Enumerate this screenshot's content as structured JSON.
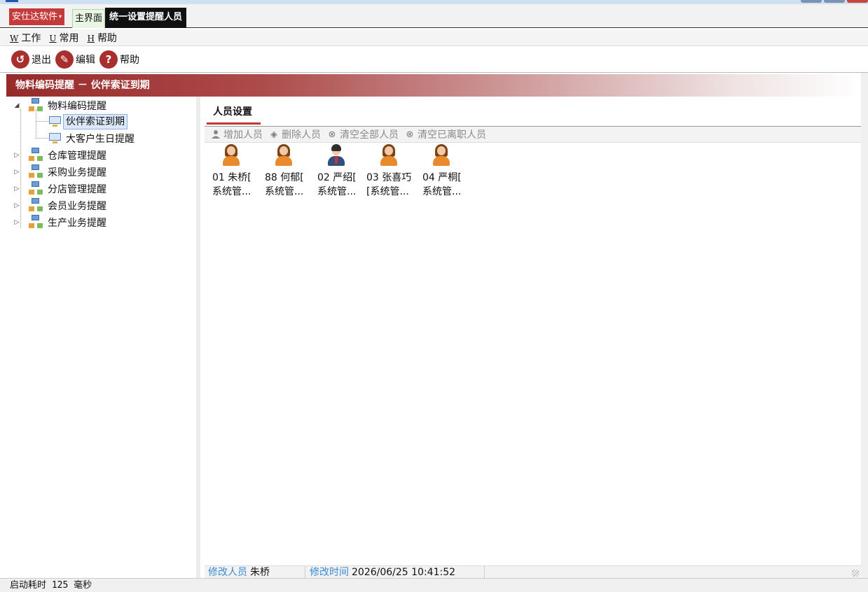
{
  "app_menu": {
    "label": "安仕达软件",
    "caret": "▾"
  },
  "tabs": [
    {
      "label": "主界面"
    },
    {
      "label": "统一设置提醒人员"
    }
  ],
  "menubar": [
    {
      "accel": "W",
      "label": "工作"
    },
    {
      "accel": "U",
      "label": "常用"
    },
    {
      "accel": "H",
      "label": "帮助"
    }
  ],
  "toolbar": [
    {
      "icon": "exit-icon",
      "glyph": "↺",
      "label": "退出"
    },
    {
      "icon": "edit-icon",
      "glyph": "✎",
      "label": "编辑"
    },
    {
      "icon": "help-icon",
      "glyph": "?",
      "label": "帮助"
    }
  ],
  "title_band": "物料编码提醒 － 伙伴索证到期",
  "tree": {
    "expanded_marker": "◢",
    "collapsed_marker": "▷",
    "nodes": [
      {
        "label": "物料编码提醒",
        "expanded": true
      },
      {
        "label": "伙伴索证到期",
        "selected": true
      },
      {
        "label": "大客户生日提醒"
      },
      {
        "label": "仓库管理提醒"
      },
      {
        "label": "采购业务提醒"
      },
      {
        "label": "分店管理提醒"
      },
      {
        "label": "会员业务提醒"
      },
      {
        "label": "生产业务提醒"
      }
    ]
  },
  "right_tab": "人员设置",
  "sub_toolbar": [
    {
      "icon": "add-person-icon",
      "glyph": "👤",
      "label": "增加人员"
    },
    {
      "icon": "delete-person-icon",
      "glyph": "◈",
      "label": "删除人员"
    },
    {
      "icon": "clear-all-icon",
      "glyph": "⊗",
      "label": "清空全部人员"
    },
    {
      "icon": "clear-resigned-icon",
      "glyph": "⊗",
      "label": "清空已离职人员"
    }
  ],
  "persons": [
    {
      "name": "01 朱桥[",
      "role": "系统管...",
      "gender": "female"
    },
    {
      "name": "88 何郁[",
      "role": "系统管...",
      "gender": "female"
    },
    {
      "name": "02 严绍[",
      "role": "系统管...",
      "gender": "male"
    },
    {
      "name": "03 张喜巧",
      "role": "[系统管...",
      "gender": "female"
    },
    {
      "name": "04 严桐[",
      "role": "系统管...",
      "gender": "female"
    }
  ],
  "info_bar": {
    "modifier_label": "修改人员",
    "modifier_value": "朱桥",
    "time_label": "修改时间",
    "time_value": "2026/06/25 10:41:52"
  },
  "status_bar": "启动耗时 125 毫秒",
  "colors": {
    "accent_red": "#c53b3b",
    "title_band_start": "#972a2a",
    "info_label_blue": "#3a8ad6"
  }
}
